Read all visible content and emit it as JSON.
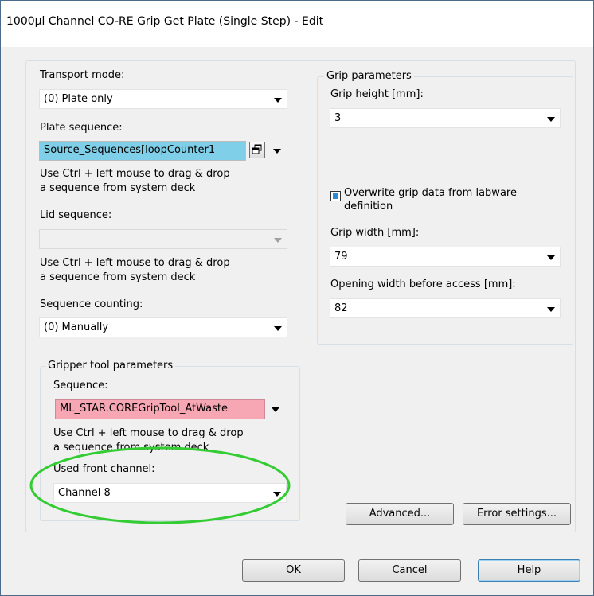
{
  "window": {
    "title": "1000µl Channel CO-RE Grip Get Plate (Single Step) - Edit"
  },
  "left": {
    "transport_mode": {
      "label": "Transport mode:",
      "value": "(0) Plate only"
    },
    "plate_sequence": {
      "label": "Plate sequence:",
      "value": "Source_Sequences[loopCounter1"
    },
    "hint1_line1": "Use Ctrl + left mouse to drag & drop",
    "hint1_line2": "a sequence from system deck",
    "lid_sequence": {
      "label": "Lid sequence:",
      "value": ""
    },
    "hint2_line1": "Use Ctrl + left mouse to drag & drop",
    "hint2_line2": "a sequence from system deck",
    "sequence_counting": {
      "label": "Sequence counting:",
      "value": "(0) Manually"
    }
  },
  "gripper_tool": {
    "title": "Gripper tool parameters",
    "sequence": {
      "label": "Sequence:",
      "value": "ML_STAR.COREGripTool_AtWaste"
    },
    "hint_line1": "Use Ctrl + left mouse to drag & drop",
    "hint_line2": "a sequence from system deck",
    "front_channel": {
      "label": "Used front channel:",
      "value": "Channel 8"
    }
  },
  "grip_parameters": {
    "title": "Grip parameters",
    "grip_height": {
      "label": "Grip height [mm]:",
      "value": "3"
    },
    "overwrite_line1": "Overwrite grip data from labware",
    "overwrite_line2": "definition",
    "grip_width": {
      "label": "Grip width [mm]:",
      "value": "79"
    },
    "opening_width": {
      "label": "Opening width before access [mm]:",
      "value": "82"
    }
  },
  "buttons": {
    "advanced": "Advanced...",
    "error_settings": "Error settings...",
    "ok": "OK",
    "cancel": "Cancel",
    "help": "Help"
  },
  "colors": {
    "plate_sequence_bg": "#7fcfe8",
    "gripper_sequence_bg": "#f7a6b3",
    "highlight_ellipse": "#33cc33"
  }
}
